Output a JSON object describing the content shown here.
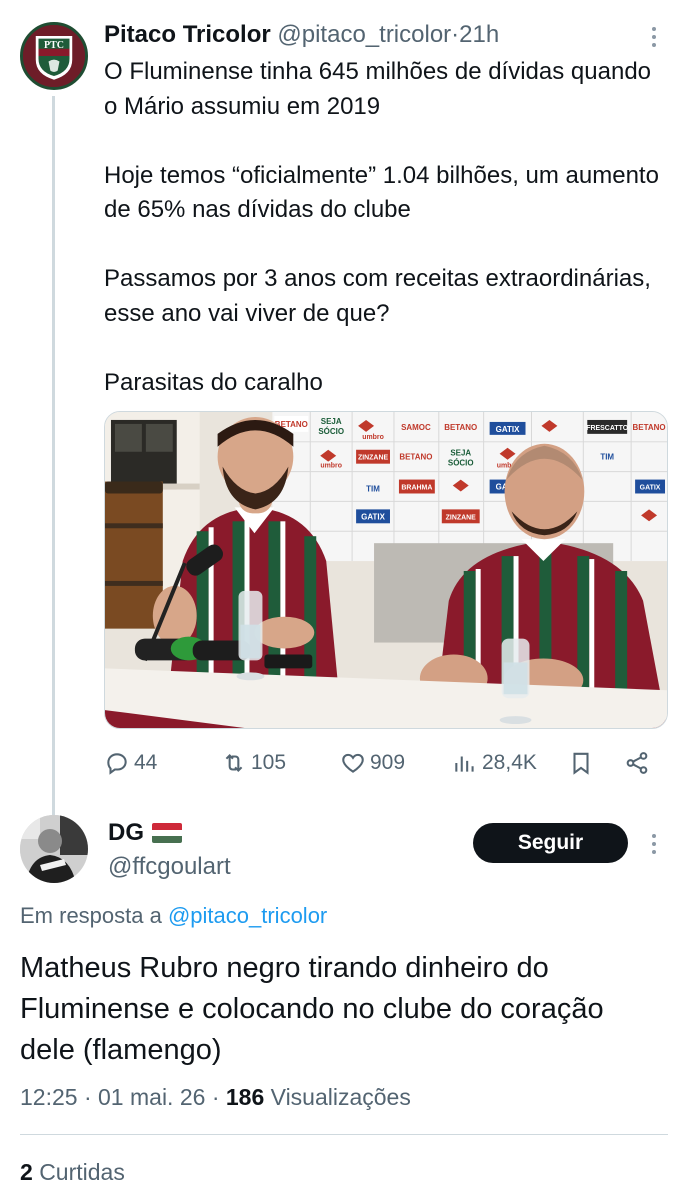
{
  "tweet": {
    "author_name": "Pitaco Tricolor",
    "author_handle": "@pitaco_tricolor",
    "separator": "·",
    "time": "21h",
    "avatar_text": "PTC",
    "paragraphs": [
      "O Fluminense tinha 645 milhões de dívidas quando o Mário assumiu em 2019",
      "Hoje temos “oficialmente” 1.04 bilhões, um aumento de 65% nas dívidas do clube",
      "Passamos por 3 anos com receitas extraordinárias, esse ano vai viver de que?",
      "Parasitas do caralho"
    ],
    "image_backdrop_text": {
      "betano": "BETANO",
      "seja_socio_1": "SEJA",
      "seja_socio_2": "SÓCIO",
      "umbro": "umbro",
      "samoc": "SAMOC",
      "gatix": "GATIX",
      "frescatto": "FRESCATTO",
      "zinzane": "ZINZANE",
      "tim": "TIM",
      "brahma": "BRAHMA"
    },
    "actions": {
      "replies": "44",
      "retweets": "105",
      "likes": "909",
      "views": "28,4K"
    }
  },
  "reply": {
    "author_name": "DG",
    "author_handle": "@ffcgoulart",
    "follow_label": "Seguir",
    "replying_prefix": "Em resposta a",
    "replying_to": "@pitaco_tricolor",
    "text": "Matheus Rubro negro tirando dinheiro do Fluminense e colocando no clube do coração dele (flamengo)",
    "time": "12:25",
    "date": "01 mai. 26",
    "separator": "·",
    "views_count": "186",
    "views_label": "Visualizações",
    "likes_count": "2",
    "likes_label": "Curtidas"
  },
  "colors": {
    "text": "#0f1419",
    "secondary": "#536471",
    "link": "#1d9bf0",
    "fluminense_grena": "#8a1a2b",
    "fluminense_green": "#1f5c3a"
  }
}
